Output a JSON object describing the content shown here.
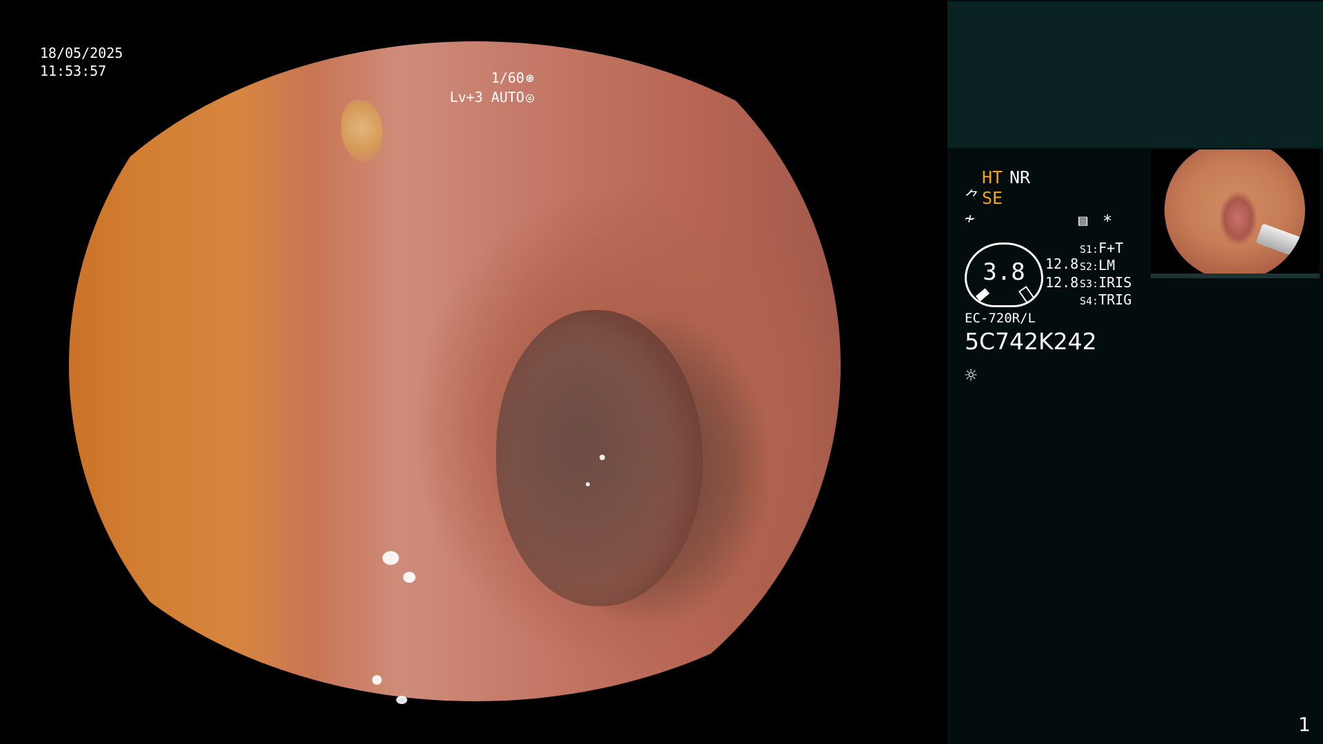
{
  "overlay": {
    "date": "18/05/2025",
    "time": "11:53:57",
    "shutter": "1/60",
    "shutter_icon": "⊛",
    "level": "Lv+3 AUTO",
    "level_icon": "◎"
  },
  "panel": {
    "ht": "HT",
    "nr": "NR",
    "se_icon": "⺈",
    "se": "SE",
    "f_icon": "≁",
    "mem_icon": "▤",
    "star": "*",
    "gauge_value": "3.8",
    "gauge_r1": "12.8",
    "gauge_r2": "12.8",
    "slots": [
      {
        "key": "S1:",
        "value": "F+T"
      },
      {
        "key": "S2:",
        "value": "LM"
      },
      {
        "key": "S3:",
        "value": "IRIS"
      },
      {
        "key": "S4:",
        "value": "TRIG"
      }
    ],
    "model": "EC-720R/L",
    "serial": "5C742K242",
    "light_icon": "☼"
  },
  "page_number": "1",
  "colors": {
    "accent": "#f2a21c",
    "panel_bg": "#030d0d",
    "panel_top_bg": "#0b2222"
  }
}
